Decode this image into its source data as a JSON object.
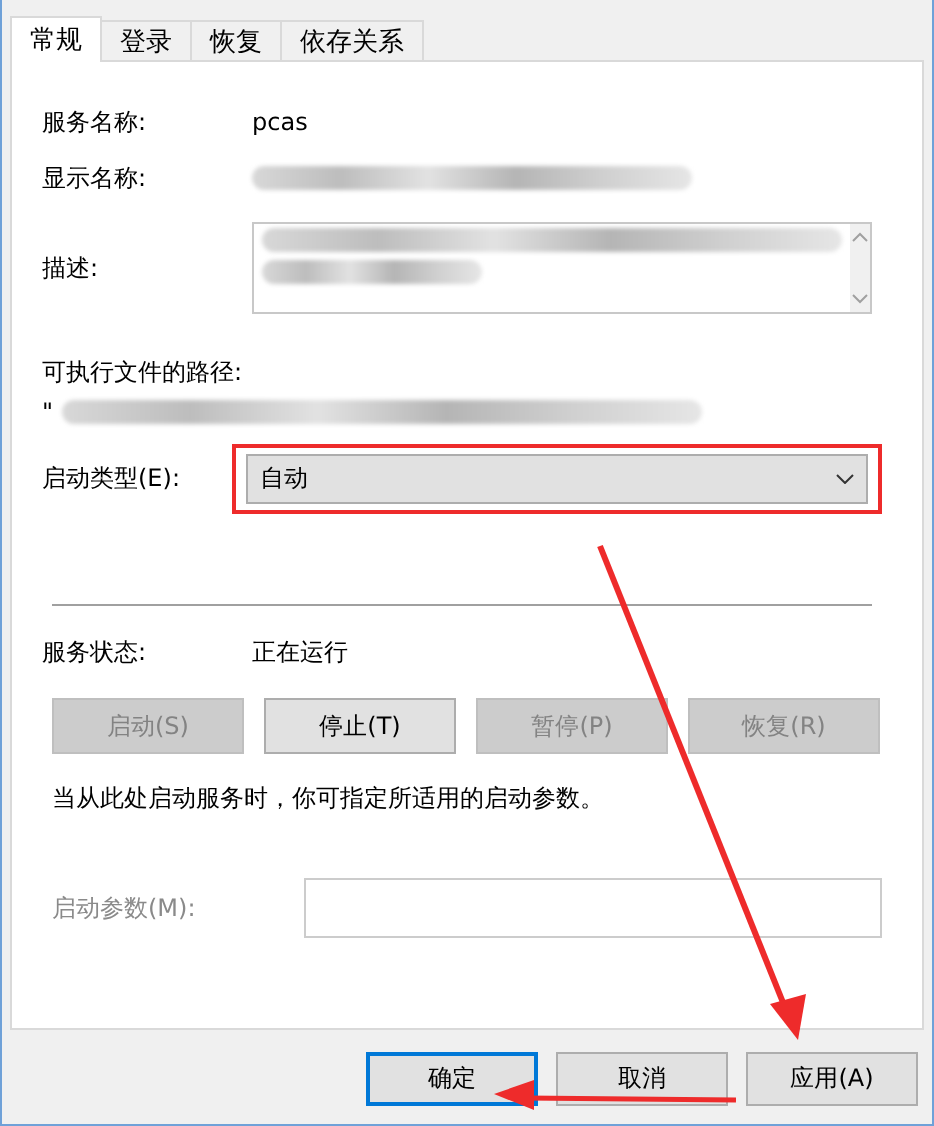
{
  "tabs": [
    {
      "label": "常规",
      "selected": true
    },
    {
      "label": "登录",
      "selected": false
    },
    {
      "label": "恢复",
      "selected": false
    },
    {
      "label": "依存关系",
      "selected": false
    }
  ],
  "service_name": {
    "label": "服务名称:",
    "value": "pcas"
  },
  "display_name": {
    "label": "显示名称:",
    "redacted": true
  },
  "description": {
    "label": "描述:",
    "redacted": true
  },
  "executable_path": {
    "label": "可执行文件的路径:",
    "value": "\"",
    "redacted": true
  },
  "startup_type": {
    "label": "启动类型(E):",
    "value": "自动",
    "highlighted": true
  },
  "service_status": {
    "label": "服务状态:",
    "value": "正在运行"
  },
  "control_buttons": [
    {
      "label": "启动(S)",
      "disabled": true
    },
    {
      "label": "停止(T)",
      "disabled": false
    },
    {
      "label": "暂停(P)",
      "disabled": true
    },
    {
      "label": "恢复(R)",
      "disabled": true
    }
  ],
  "hint": "当从此处启动服务时，你可指定所适用的启动参数。",
  "start_parameters": {
    "label": "启动参数(M):",
    "disabled": true
  },
  "dialog_buttons": [
    {
      "label": "确定",
      "default": true
    },
    {
      "label": "取消",
      "default": false
    },
    {
      "label": "应用(A)",
      "default": false
    }
  ],
  "annotations": {
    "arrow_to_apply": true,
    "arrow_to_ok": true
  }
}
